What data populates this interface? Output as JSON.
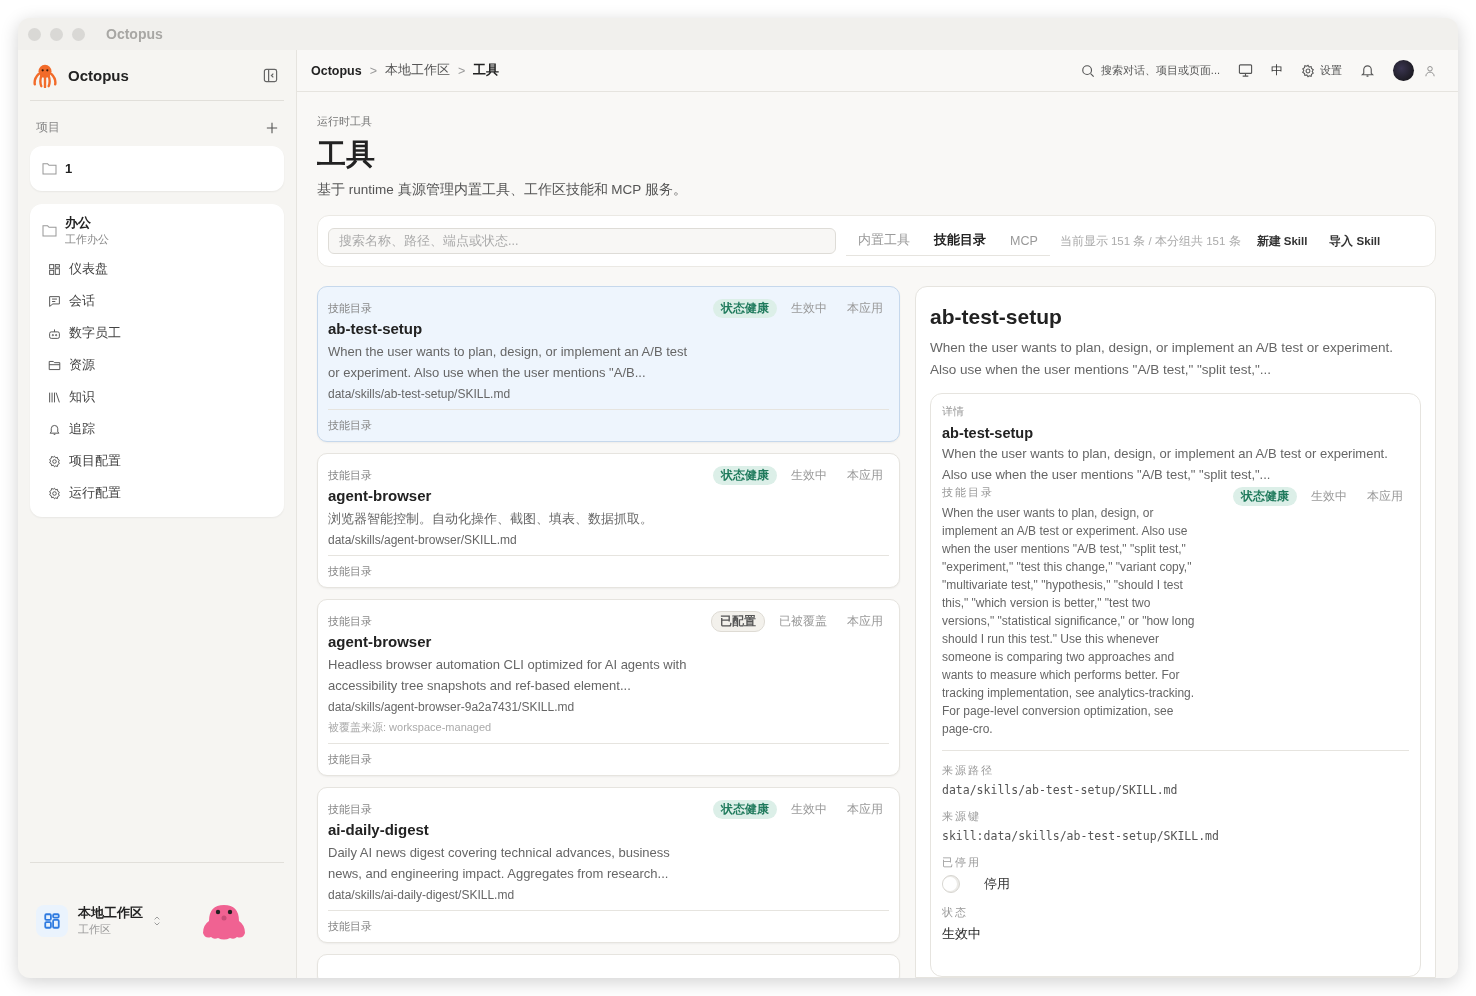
{
  "window": {
    "title": "Octopus"
  },
  "sidebar": {
    "app_name": "Octopus",
    "projects_label": "项目",
    "projects": [
      {
        "name": "1",
        "selected": false
      }
    ],
    "workspace": {
      "name": "办公",
      "subtitle": "工作办公",
      "items": [
        {
          "label": "仪表盘",
          "selected": false
        },
        {
          "label": "会话",
          "selected": false
        },
        {
          "label": "数字员工",
          "selected": false
        },
        {
          "label": "资源",
          "selected": false
        },
        {
          "label": "知识",
          "selected": false
        },
        {
          "label": "追踪",
          "selected": false
        },
        {
          "label": "项目配置",
          "selected": false
        },
        {
          "label": "运行配置",
          "selected": false
        }
      ]
    },
    "footer": {
      "name": "本地工作区",
      "subtitle": "工作区"
    }
  },
  "topbar": {
    "breadcrumb": [
      {
        "label": "Octopus"
      },
      {
        "label": "本地工作区"
      },
      {
        "label": "工具"
      }
    ],
    "separator": ">",
    "search_placeholder": "搜索对话、项目或页面...",
    "language": "中",
    "settings": "设置"
  },
  "page": {
    "eyebrow": "运行时工具",
    "title": "工具",
    "subtitle": "基于 runtime 真源管理内置工具、工作区技能和 MCP 服务。"
  },
  "toolbar": {
    "search_placeholder": "搜索名称、路径、端点或状态...",
    "tabs": [
      {
        "label": "内置工具",
        "selected": false
      },
      {
        "label": "技能目录",
        "selected": true
      },
      {
        "label": "MCP",
        "selected": false
      }
    ],
    "count": "当前显示 151 条 / 本分组共 151 条",
    "buttons": [
      "新建 Skill",
      "导入 Skill"
    ]
  },
  "cards": [
    {
      "category": "技能目录",
      "name": "ab-test-setup",
      "description": "When the user wants to plan, design, or implement an A/B test or experiment. Also use when the user mentions \"A/B...",
      "path": "data/skills/ab-test-setup/SKILL.md",
      "footer": "技能目录",
      "selected": true,
      "badges": [
        {
          "label": "状态健康",
          "kind": "healthy"
        },
        {
          "label": "生效中",
          "kind": "plain"
        },
        {
          "label": "本应用",
          "kind": "plain"
        }
      ]
    },
    {
      "category": "技能目录",
      "name": "agent-browser",
      "description": "浏览器智能控制。自动化操作、截图、填表、数据抓取。",
      "path": "data/skills/agent-browser/SKILL.md",
      "footer": "技能目录",
      "selected": false,
      "badges": [
        {
          "label": "状态健康",
          "kind": "healthy"
        },
        {
          "label": "生效中",
          "kind": "plain"
        },
        {
          "label": "本应用",
          "kind": "plain"
        }
      ]
    },
    {
      "category": "技能目录",
      "name": "agent-browser",
      "description": "Headless browser automation CLI optimized for AI agents with accessibility tree snapshots and ref-based element...",
      "path": "data/skills/agent-browser-9a2a7431/SKILL.md",
      "note": "被覆盖来源: workspace-managed",
      "footer": "技能目录",
      "selected": false,
      "badges": [
        {
          "label": "已配置",
          "kind": "configured"
        },
        {
          "label": "已被覆盖",
          "kind": "plain"
        },
        {
          "label": "本应用",
          "kind": "plain"
        }
      ]
    },
    {
      "category": "技能目录",
      "name": "ai-daily-digest",
      "description": "Daily AI news digest covering technical advances, business news, and engineering impact. Aggregates from research...",
      "path": "data/skills/ai-daily-digest/SKILL.md",
      "footer": "技能目录",
      "selected": false,
      "badges": [
        {
          "label": "状态健康",
          "kind": "healthy"
        },
        {
          "label": "生效中",
          "kind": "plain"
        },
        {
          "label": "本应用",
          "kind": "plain"
        }
      ]
    }
  ],
  "detail": {
    "title": "ab-test-setup",
    "description": "When the user wants to plan, design, or implement an A/B test or experiment. Also use when the user mentions \"A/B test,\" \"split test,\"...",
    "section_label": "详情",
    "name": "ab-test-setup",
    "summary": "When the user wants to plan, design, or implement an A/B test or experiment. Also use when the user mentions \"A/B test,\" \"split test,\"...",
    "category": "技能目录",
    "full_description": "When the user wants to plan, design, or implement an A/B test or experiment. Also use when the user mentions \"A/B test,\" \"split test,\" \"experiment,\" \"test this change,\" \"variant copy,\" \"multivariate test,\" \"hypothesis,\" \"should I test this,\" \"which version is better,\" \"test two versions,\" \"statistical significance,\" or \"how long should I run this test.\" Use this whenever someone is comparing two approaches and wants to measure which performs better. For tracking implementation, see analytics-tracking. For page-level conversion optimization, see page-cro.",
    "badges": [
      {
        "label": "状态健康",
        "kind": "healthy"
      },
      {
        "label": "生效中",
        "kind": "plain"
      },
      {
        "label": "本应用",
        "kind": "plain"
      }
    ],
    "fields": [
      {
        "label": "来源路径",
        "value": "data/skills/ab-test-setup/SKILL.md",
        "kind": "mono"
      },
      {
        "label": "来源键",
        "value": "skill:data/skills/ab-test-setup/SKILL.md",
        "kind": "mono"
      },
      {
        "label": "已停用",
        "value": "停用",
        "kind": "toggle",
        "checked": false
      },
      {
        "label": "状态",
        "value": "生效中",
        "kind": "text"
      }
    ]
  }
}
